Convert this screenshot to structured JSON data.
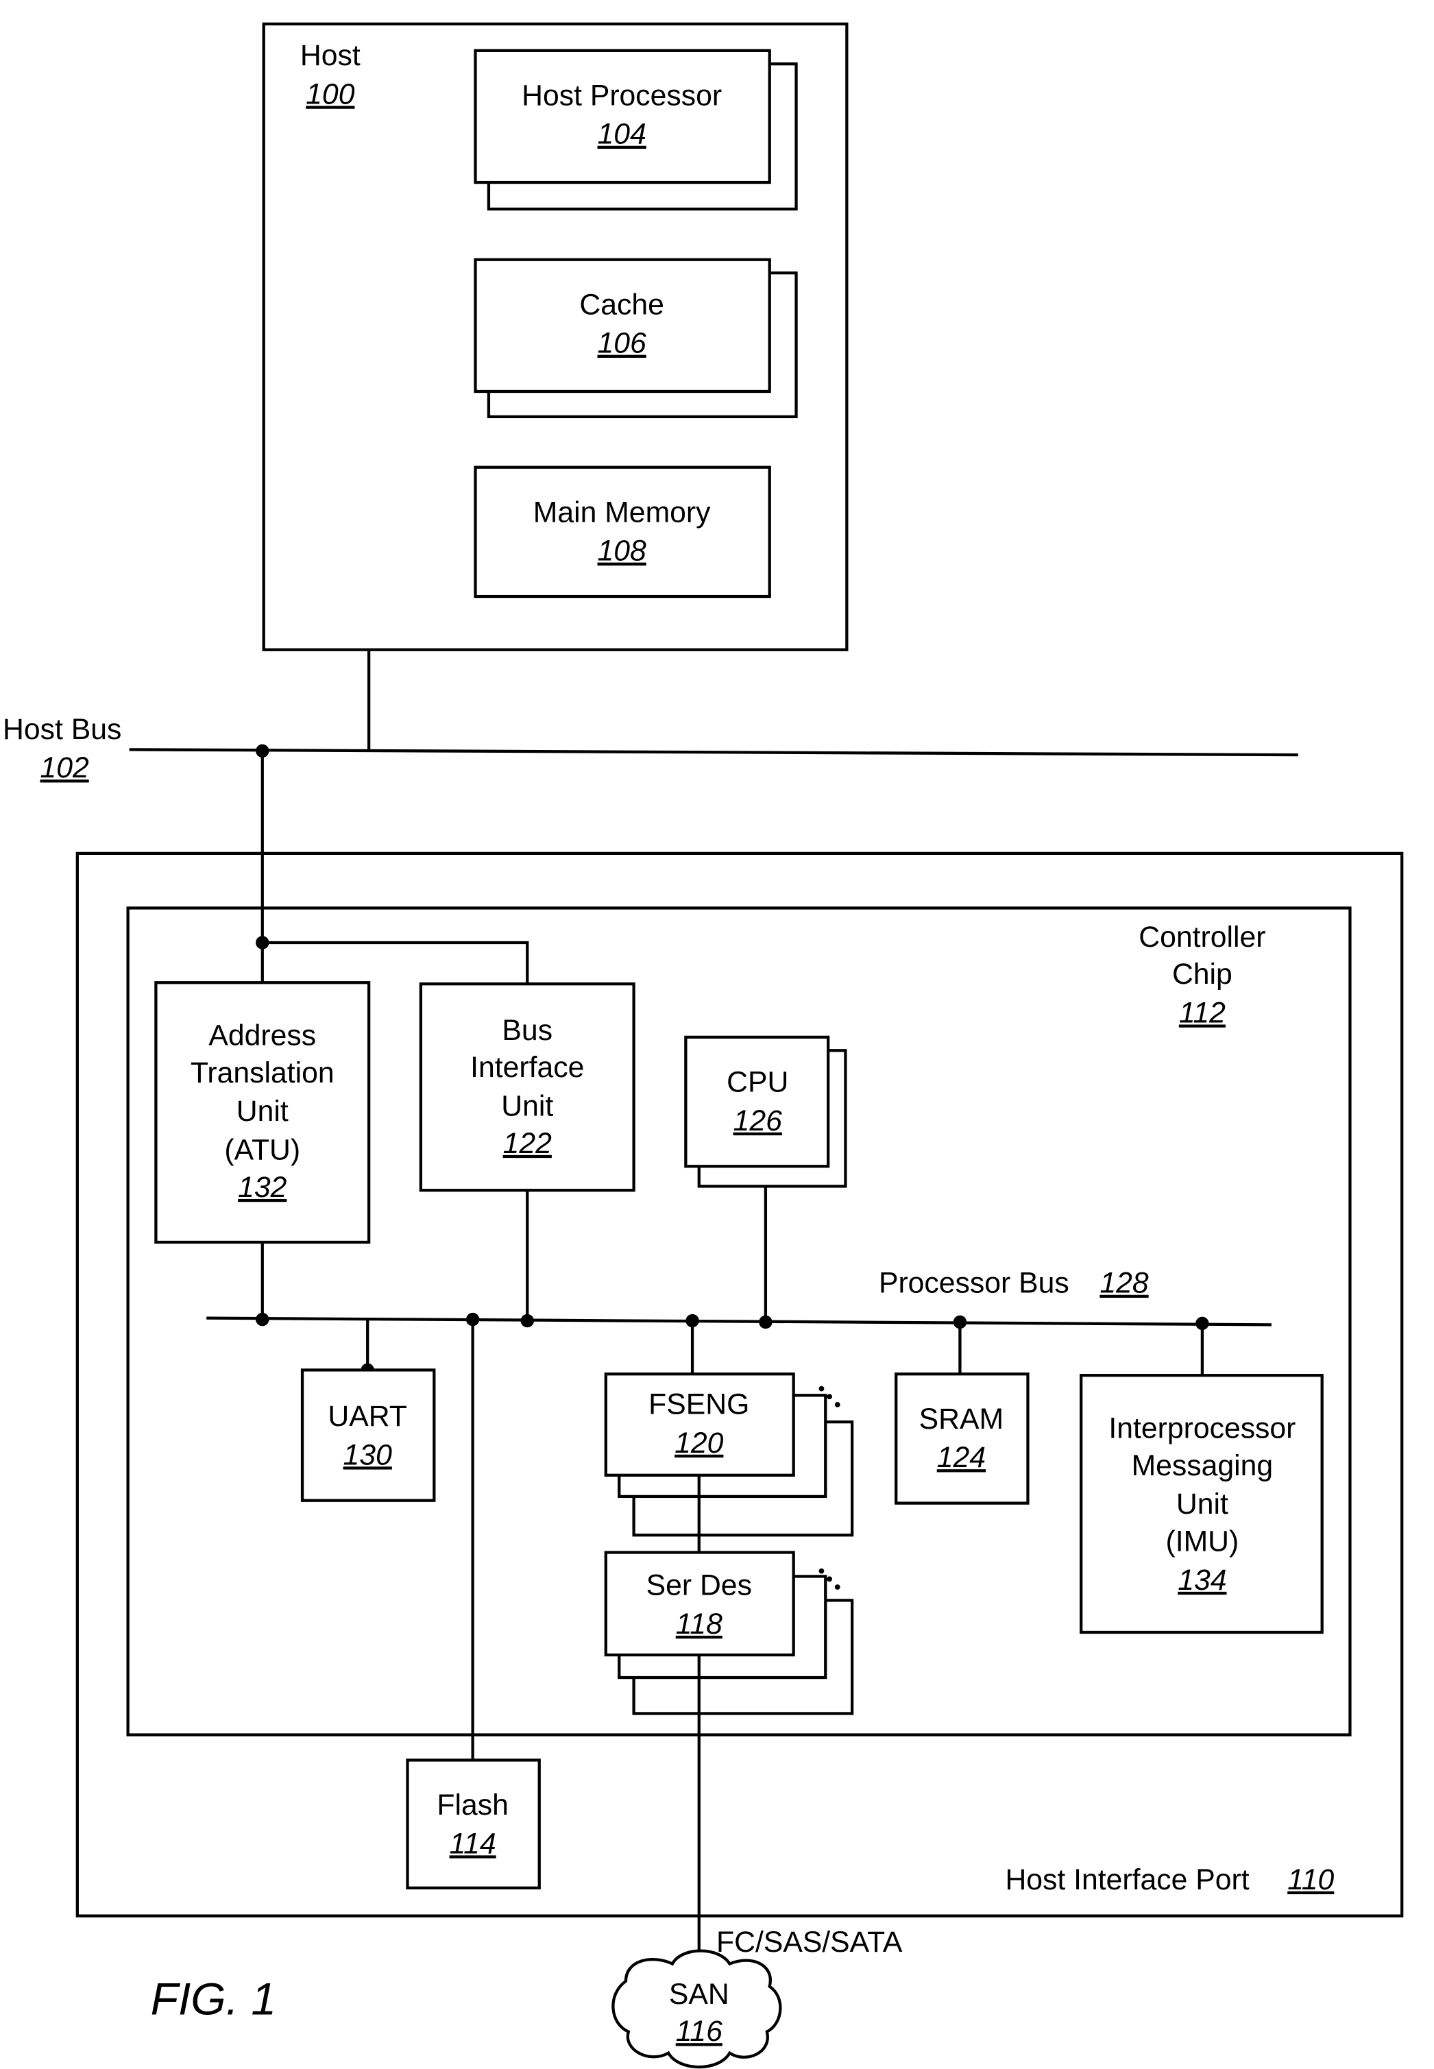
{
  "figure_label": "FIG. 1",
  "host": {
    "label": "Host",
    "ref": "100"
  },
  "host_processor": {
    "label": "Host Processor",
    "ref": "104"
  },
  "cache": {
    "label": "Cache",
    "ref": "106"
  },
  "main_memory": {
    "label": "Main Memory",
    "ref": "108"
  },
  "host_bus": {
    "label": "Host Bus",
    "ref": "102"
  },
  "host_interface_port": {
    "label": "Host Interface Port",
    "ref": "110"
  },
  "controller_chip": {
    "line1": "Controller",
    "line2": "Chip",
    "ref": "112"
  },
  "atu": {
    "line1": "Address",
    "line2": "Translation",
    "line3": "Unit",
    "line4": "(ATU)",
    "ref": "132"
  },
  "biu": {
    "line1": "Bus",
    "line2": "Interface",
    "line3": "Unit",
    "ref": "122"
  },
  "cpu": {
    "label": "CPU",
    "ref": "126"
  },
  "processor_bus": {
    "label": "Processor Bus",
    "ref": "128"
  },
  "uart": {
    "label": "UART",
    "ref": "130"
  },
  "fseng": {
    "label": "FSENG",
    "ref": "120"
  },
  "sram": {
    "label": "SRAM",
    "ref": "124"
  },
  "imu": {
    "line1": "Interprocessor",
    "line2": "Messaging",
    "line3": "Unit",
    "line4": "(IMU)",
    "ref": "134"
  },
  "serdes": {
    "label": "Ser Des",
    "ref": "118"
  },
  "flash": {
    "label": "Flash",
    "ref": "114"
  },
  "link": {
    "label": "FC/SAS/SATA"
  },
  "san": {
    "label": "SAN",
    "ref": "116"
  }
}
